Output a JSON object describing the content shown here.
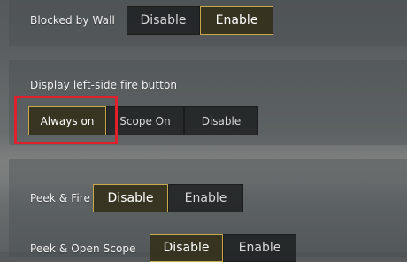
{
  "settings": {
    "blocked_by_wall": {
      "label": "Blocked by Wall",
      "options": [
        "Disable",
        "Enable"
      ],
      "selected": "Enable"
    },
    "left_fire_button": {
      "label": "Display left-side fire button",
      "options": [
        "Always on",
        "Scope On",
        "Disable"
      ],
      "selected": "Always on"
    },
    "peek_fire": {
      "label": "Peek & Fire",
      "options": [
        "Disable",
        "Enable"
      ],
      "selected": "Disable"
    },
    "peek_open_scope": {
      "label": "Peek & Open Scope",
      "options": [
        "Disable",
        "Enable"
      ]
    }
  },
  "colors": {
    "selected_border": "#c8a94a",
    "highlight_box": "#e0202a"
  }
}
